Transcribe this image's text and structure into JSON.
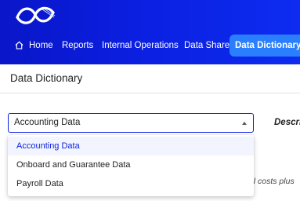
{
  "nav": {
    "items": [
      {
        "label": "Home",
        "icon": "home-icon"
      },
      {
        "label": "Reports"
      },
      {
        "label": "Internal Operations"
      },
      {
        "label": "Data Share"
      },
      {
        "label": "Data Dictionary",
        "active": true
      }
    ]
  },
  "page": {
    "title": "Data Dictionary"
  },
  "dataset_select": {
    "value": "Accounting Data",
    "options": [
      "Accounting Data",
      "Onboard and Guarantee Data",
      "Payroll Data"
    ]
  },
  "description_label": "Descri",
  "partial_text": "tal costs plus",
  "colors": {
    "nav_bg": "#0b1fe0",
    "nav_active": "#2a7fff",
    "accent": "#0b1fe0"
  }
}
